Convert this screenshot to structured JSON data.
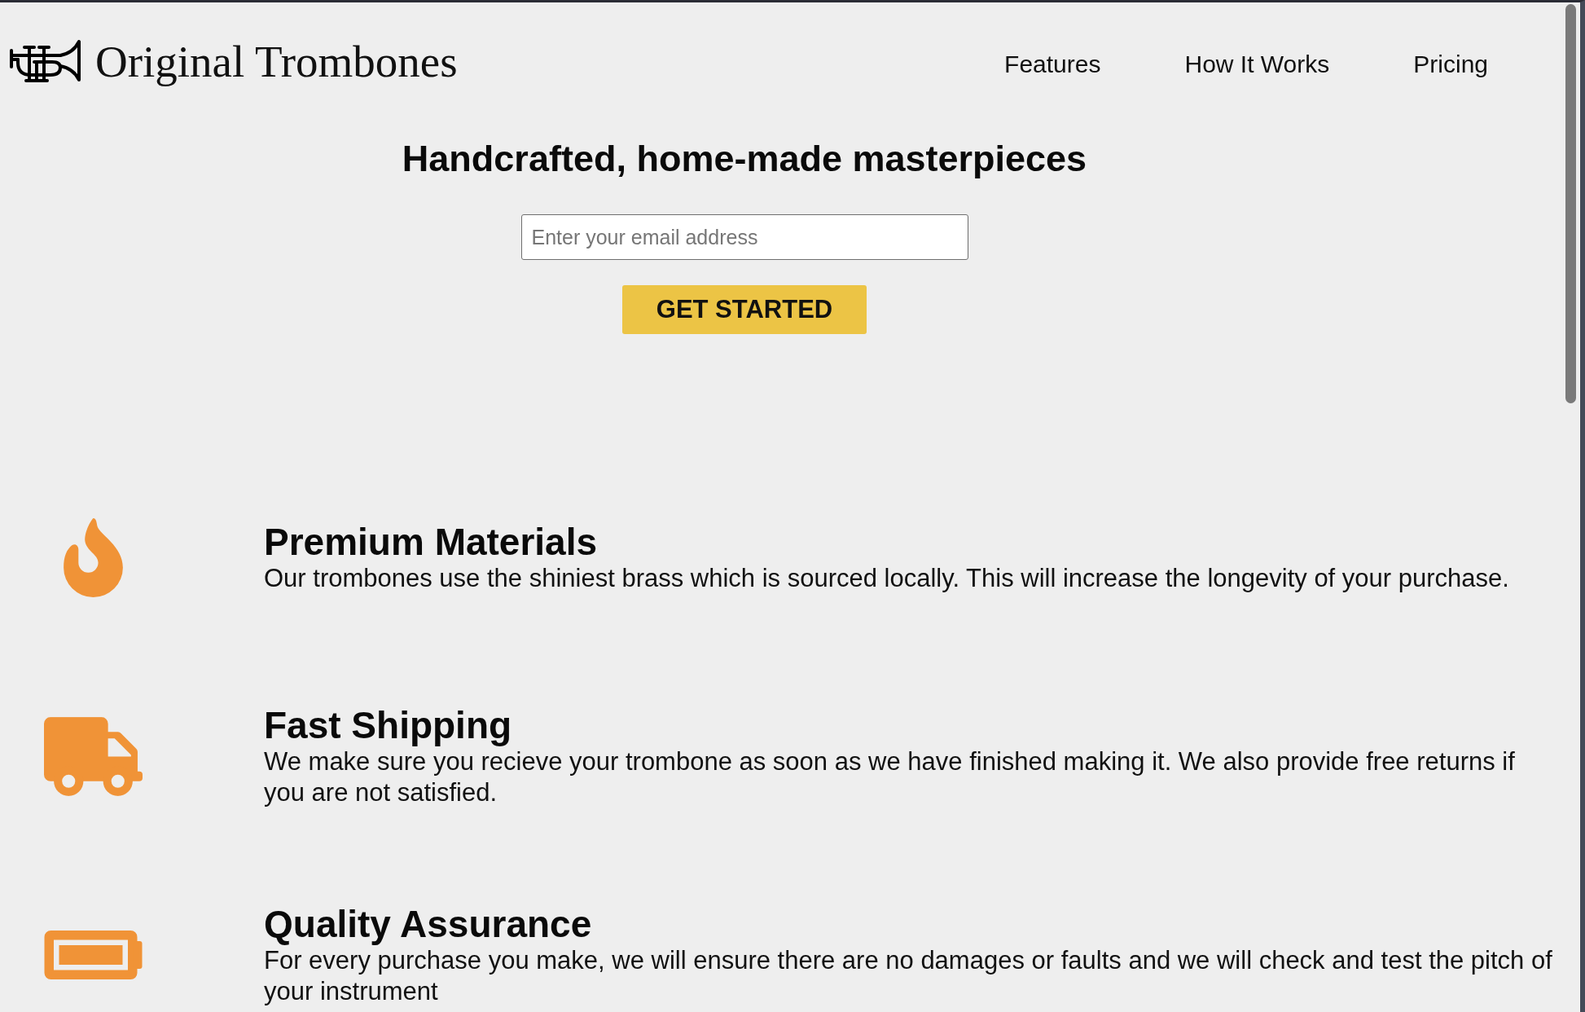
{
  "header": {
    "logo_text": "Original Trombones",
    "nav": [
      "Features",
      "How It Works",
      "Pricing"
    ]
  },
  "hero": {
    "heading": "Handcrafted, home-made masterpieces",
    "email_field": {
      "placeholder": "Enter your email address"
    },
    "button": "GET STARTED"
  },
  "features": [
    {
      "title": "Premium Materials",
      "description": "Our trombones use the shiniest brass which is sourced locally. This will increase the longevity of your purchase."
    },
    {
      "title": "Fast Shipping",
      "description": "We make sure you recieve your trombone as soon as we have finished making it. We also provide free returns if you are not satisfied."
    },
    {
      "title": "Quality Assurance",
      "description": "For every purchase you make, we will ensure there are no damages or faults and we will check and test the pitch of your instrument"
    }
  ]
}
